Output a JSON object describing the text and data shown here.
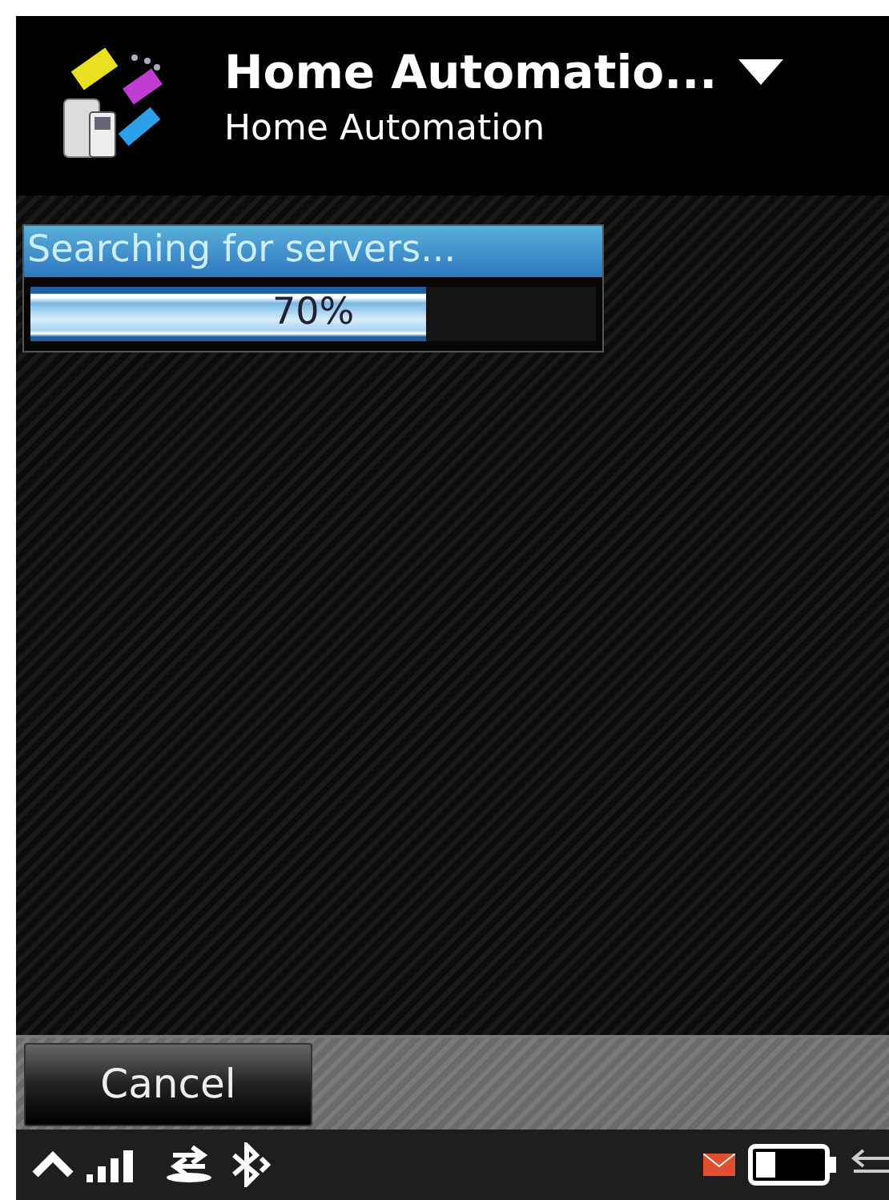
{
  "header": {
    "title": "Home Automatio...",
    "subtitle": "Home Automation"
  },
  "progress": {
    "label": "Searching for servers...",
    "reading": "70%",
    "level": 0.7
  },
  "softkeys": {
    "left": "Cancel"
  }
}
